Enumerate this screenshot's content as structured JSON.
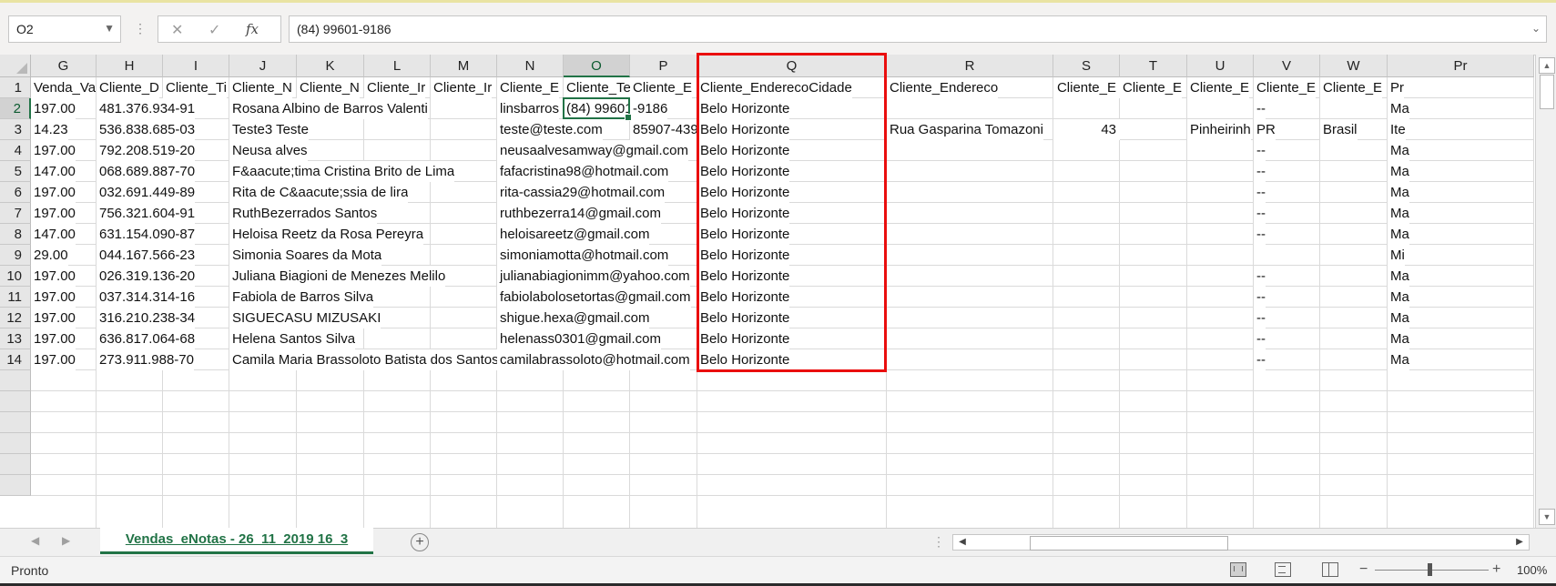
{
  "formula_bar": {
    "name_box": "O2",
    "formula": "(84) 99601-9186",
    "cancel_icon": "✕",
    "enter_icon": "✓",
    "fx_label": "fx"
  },
  "columns": [
    "G",
    "H",
    "I",
    "J",
    "K",
    "L",
    "M",
    "N",
    "O",
    "P",
    "Q",
    "R",
    "S",
    "T",
    "U",
    "V",
    "W",
    "Pr"
  ],
  "rows": [
    "1",
    "2",
    "3",
    "4",
    "5",
    "6",
    "7",
    "8",
    "9",
    "10",
    "11",
    "12",
    "13",
    "14"
  ],
  "headers": {
    "G": "Venda_Va",
    "H": "Cliente_D",
    "I": "Cliente_Ti",
    "J": "Cliente_N",
    "K": "Cliente_N",
    "L": "Cliente_Ir",
    "M": "Cliente_Ir",
    "N": "Cliente_E",
    "O": "Cliente_Te",
    "P": "Cliente_E",
    "Q": "Cliente_EnderecoCidade",
    "R": "Cliente_Endereco",
    "S": "Cliente_E",
    "T": "Cliente_E",
    "U": "Cliente_E",
    "V": "Cliente_E",
    "W": "Cliente_E",
    "X": "Pr"
  },
  "data": [
    {
      "G": "197.00",
      "H": "481.376.934-91",
      "J": "Rosana Albino de Barros Valenti",
      "N": "linsbarros",
      "O": "(84) 99601",
      "P": "-9186",
      "Q": "Belo Horizonte",
      "V": "--",
      "X": "Ma"
    },
    {
      "G": "14.23",
      "H": "536.838.685-03",
      "J": "Teste3 Teste",
      "N": "teste@teste.com",
      "P": "85907-439",
      "Q": "Belo Horizonte",
      "R": "Rua Gasparina Tomazoni",
      "S": "43",
      "U": "Pinheirinh",
      "V": "PR",
      "W": "Brasil",
      "X": "Ite"
    },
    {
      "G": "197.00",
      "H": "792.208.519-20",
      "J": "Neusa alves",
      "N": "neusaalvesamway@gmail.com",
      "Q": "Belo Horizonte",
      "V": "--",
      "X": "Ma"
    },
    {
      "G": "147.00",
      "H": "068.689.887-70",
      "J": "F&aacute;tima Cristina Brito de Lima",
      "N": "fafacristina98@hotmail.com",
      "Q": "Belo Horizonte",
      "V": "--",
      "X": "Ma"
    },
    {
      "G": "197.00",
      "H": "032.691.449-89",
      "J": "Rita de C&aacute;ssia de lira",
      "N": "rita-cassia29@hotmail.com",
      "Q": "Belo Horizonte",
      "V": "--",
      "X": "Ma"
    },
    {
      "G": "197.00",
      "H": "756.321.604-91",
      "J": "RuthBezerrados Santos",
      "N": "ruthbezerra14@gmail.com",
      "Q": "Belo Horizonte",
      "V": "--",
      "X": "Ma"
    },
    {
      "G": "147.00",
      "H": "631.154.090-87",
      "J": "Heloisa Reetz da Rosa Pereyra",
      "N": "heloisareetz@gmail.com",
      "Q": "Belo Horizonte",
      "V": "--",
      "X": "Ma"
    },
    {
      "G": "29.00",
      "H": "044.167.566-23",
      "J": "Simonia Soares da Mota",
      "N": "simoniamotta@hotmail.com",
      "Q": "Belo Horizonte",
      "X": "Mi"
    },
    {
      "G": "197.00",
      "H": "026.319.136-20",
      "J": "Juliana Biagioni de Menezes Melilo",
      "N": "julianabiagionimm@yahoo.com",
      "Q": "Belo Horizonte",
      "V": "--",
      "X": "Ma"
    },
    {
      "G": "197.00",
      "H": "037.314.314-16",
      "J": "Fabiola de Barros Silva",
      "N": "fabiolabolosetortas@gmail.com",
      "Q": "Belo Horizonte",
      "V": "--",
      "X": "Ma"
    },
    {
      "G": "197.00",
      "H": "316.210.238-34",
      "J": "SIGUECASU MIZUSAKI",
      "N": "shigue.hexa@gmail.com",
      "Q": "Belo Horizonte",
      "V": "--",
      "X": "Ma"
    },
    {
      "G": "197.00",
      "H": "636.817.064-68",
      "J": "Helena Santos Silva",
      "N": "helenass0301@gmail.com",
      "Q": "Belo Horizonte",
      "V": "--",
      "X": "Ma"
    },
    {
      "G": "197.00",
      "H": "273.911.988-70",
      "J": "Camila Maria Brassoloto Batista dos Santos",
      "N": "camilabrassoloto@hotmail.com",
      "Q": "Belo Horizonte",
      "V": "--",
      "X": "Ma"
    }
  ],
  "sheet_tab": "Vendas_eNotas - 26_11_2019 16_3",
  "status_text": "Pronto",
  "zoom": "100%",
  "active_cell": "O2",
  "selected_column": "O",
  "selected_row": "2",
  "highlight_column": "Q",
  "colors": {
    "accent": "#217346",
    "highlight_border": "#ea0e0e"
  }
}
